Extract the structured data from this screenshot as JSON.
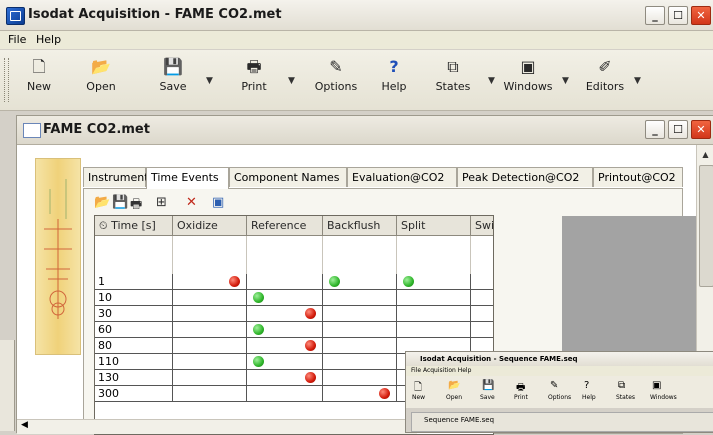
{
  "app": {
    "title": "Isodat Acquisition - FAME CO2.met"
  },
  "menu": [
    "File",
    "Help"
  ],
  "toolbar": [
    {
      "label": "New",
      "icon": "new-file-icon",
      "glyph": "🗋",
      "dropdown": false
    },
    {
      "label": "Open",
      "icon": "open-folder-icon",
      "glyph": "📂",
      "dropdown": false
    },
    {
      "label": "Save",
      "icon": "save-disk-icon",
      "glyph": "💾",
      "dropdown": true
    },
    {
      "label": "Print",
      "icon": "printer-icon",
      "glyph": "🖶",
      "dropdown": true
    },
    {
      "label": "Options",
      "icon": "options-icon",
      "glyph": "✎",
      "dropdown": false
    },
    {
      "label": "Help",
      "icon": "help-icon",
      "glyph": "?",
      "dropdown": false
    },
    {
      "label": "States",
      "icon": "states-icon",
      "glyph": "⧉",
      "dropdown": true
    },
    {
      "label": "Windows",
      "icon": "windows-icon",
      "glyph": "▣",
      "dropdown": true
    },
    {
      "label": "Editors",
      "icon": "editors-icon",
      "glyph": "✐",
      "dropdown": true
    }
  ],
  "document": {
    "title": "FAME CO2.met",
    "tabs": [
      "Instrument",
      "Time Events",
      "Component Names",
      "Evaluation@CO2",
      "Peak Detection@CO2",
      "Printout@CO2"
    ],
    "active_tab": "Time Events",
    "table": {
      "columns": [
        "Time [s]",
        "Oxidize",
        "Reference",
        "Backflush",
        "Split",
        "Switch Gas"
      ],
      "rows": [
        {
          "time": "1",
          "marks": {
            "Oxidize": "red",
            "Backflush": "green",
            "Split": "green"
          }
        },
        {
          "time": "10",
          "marks": {
            "Reference": "green"
          }
        },
        {
          "time": "30",
          "marks": {
            "Reference": "red"
          }
        },
        {
          "time": "60",
          "marks": {
            "Reference": "green"
          }
        },
        {
          "time": "80",
          "marks": {
            "Reference": "red"
          }
        },
        {
          "time": "110",
          "marks": {
            "Reference": "green"
          }
        },
        {
          "time": "130",
          "marks": {
            "Reference": "red"
          }
        },
        {
          "time": "300",
          "marks": {
            "Backflush": "red"
          }
        }
      ]
    }
  },
  "colors": {
    "red_mark": "#d21a0a",
    "green_mark": "#2fb52a",
    "close_button": "#d2361a",
    "grid_gray": "#a3a3a3"
  },
  "second_window": {
    "title": "Isodat Acquisition - Sequence FAME.seq",
    "menu": "File  Acquisition  Help",
    "toolbar": [
      "New",
      "Open",
      "Save",
      "Print",
      "Options",
      "Help",
      "States",
      "Windows"
    ],
    "doc_title": "Sequence FAME.seq"
  }
}
